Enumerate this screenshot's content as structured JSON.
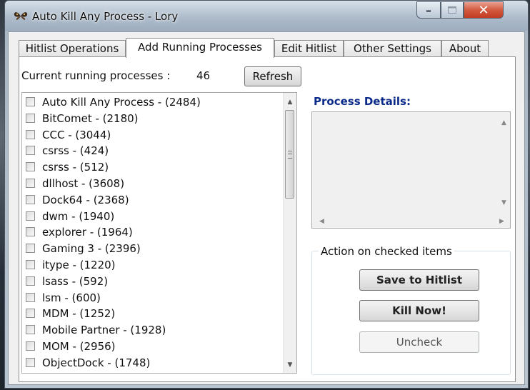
{
  "window": {
    "title": "Auto Kill Any Process - Lory"
  },
  "tabs": [
    {
      "label": "Hitlist Operations"
    },
    {
      "label": "Add Running Processes"
    },
    {
      "label": "Edit Hitlist"
    },
    {
      "label": "Other Settings"
    },
    {
      "label": "About"
    }
  ],
  "active_tab": "Add Running Processes",
  "header": {
    "count_label": "Current running processes :",
    "count_value": "46",
    "refresh_label": "Refresh"
  },
  "processes": [
    "Auto Kill Any Process - (2484)",
    "BitComet - (2180)",
    "CCC - (3044)",
    "csrss - (424)",
    "csrss - (512)",
    "dllhost - (3608)",
    "Dock64 - (2368)",
    "dwm - (1940)",
    "explorer - (1964)",
    "Gaming 3 - (2396)",
    "itype - (1220)",
    "lsass - (592)",
    "lsm - (600)",
    "MDM - (1252)",
    "Mobile Partner - (1928)",
    "MOM - (2956)",
    "ObjectDock - (1748)"
  ],
  "details": {
    "label": "Process Details:"
  },
  "actions": {
    "group_title": "Action on checked items",
    "save_label": "Save to Hitlist",
    "kill_label": "Kill Now!",
    "uncheck_label": "Uncheck"
  },
  "icons": {
    "app": "butterfly-icon",
    "minimize": "minimize-icon",
    "maximize": "maximize-icon",
    "close": "close-icon"
  },
  "colors": {
    "details_label": "#0a2a8a",
    "close_button": "#c13b22"
  }
}
